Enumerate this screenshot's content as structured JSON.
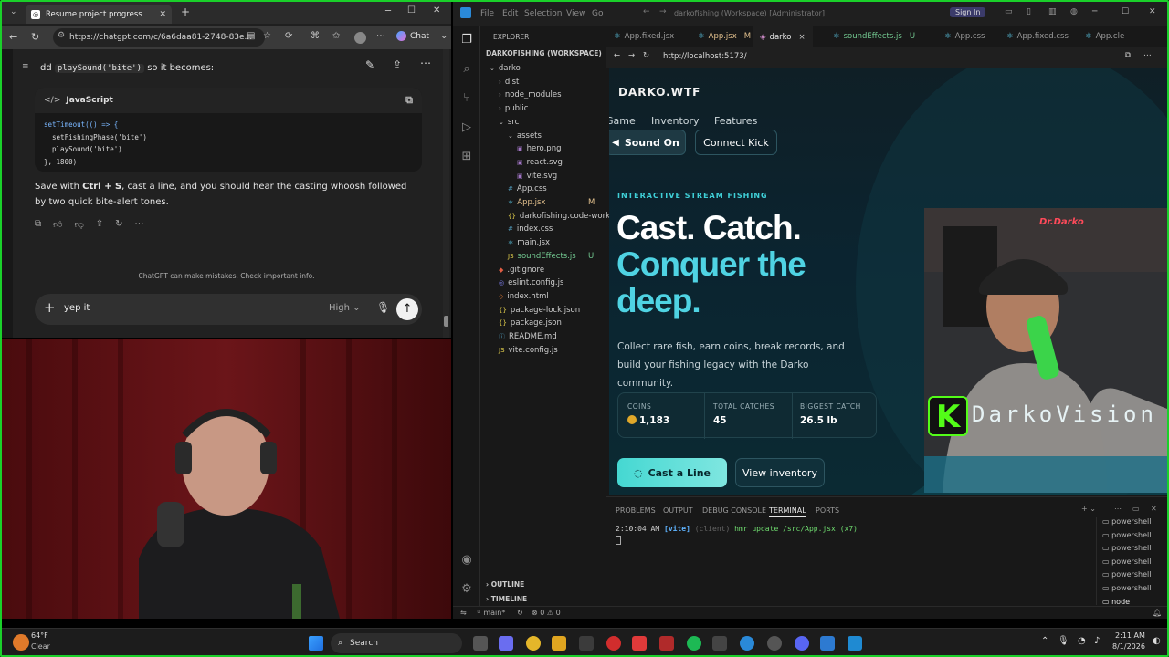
{
  "browser": {
    "tab_title": "Resume project progress",
    "url": "https://chatgpt.com/c/6a6daa81-2748-83e...",
    "chat_button": "Chat"
  },
  "chat": {
    "intro_prefix": "dd",
    "intro_code": "playSound('bite')",
    "intro_suffix": "so it becomes:",
    "code_lang": "JavaScript",
    "code_lines": [
      "setTimeout(() => {",
      "  setFishingPhase('bite')",
      "  playSound('bite')",
      "}, 1800)"
    ],
    "reply_pre": "Save with ",
    "reply_keys": "Ctrl + S",
    "reply_post": ", cast a line, and you should hear the casting whoosh followed by two quick bite-alert tones.",
    "disclaimer": "ChatGPT can make mistakes. Check important info.",
    "input_value": "yep it",
    "model_effort": "High"
  },
  "vscode": {
    "title": "darkofishing (Workspace) [Administrator]",
    "menu": [
      "File",
      "Edit",
      "Selection",
      "View",
      "Go"
    ],
    "sign_in": "Sign In",
    "explorer_header": "EXPLORER",
    "workspace": "DARKOFISHING (WORKSPACE)",
    "tree": [
      {
        "name": "darko",
        "depth": 0,
        "kind": "folder-open",
        "badge": ""
      },
      {
        "name": "dist",
        "depth": 1,
        "kind": "folder",
        "badge": ""
      },
      {
        "name": "node_modules",
        "depth": 1,
        "kind": "folder",
        "badge": ""
      },
      {
        "name": "public",
        "depth": 1,
        "kind": "folder",
        "badge": ""
      },
      {
        "name": "src",
        "depth": 1,
        "kind": "folder-open",
        "badge": ""
      },
      {
        "name": "assets",
        "depth": 2,
        "kind": "folder-open",
        "badge": ""
      },
      {
        "name": "hero.png",
        "depth": 3,
        "kind": "img",
        "badge": ""
      },
      {
        "name": "react.svg",
        "depth": 3,
        "kind": "img",
        "badge": ""
      },
      {
        "name": "vite.svg",
        "depth": 3,
        "kind": "img",
        "badge": ""
      },
      {
        "name": "App.css",
        "depth": 2,
        "kind": "css",
        "badge": ""
      },
      {
        "name": "App.jsx",
        "depth": 2,
        "kind": "jsx",
        "badge": "M"
      },
      {
        "name": "darkofishing.code-worksp...",
        "depth": 2,
        "kind": "json",
        "badge": ""
      },
      {
        "name": "index.css",
        "depth": 2,
        "kind": "css",
        "badge": ""
      },
      {
        "name": "main.jsx",
        "depth": 2,
        "kind": "jsx",
        "badge": ""
      },
      {
        "name": "soundEffects.js",
        "depth": 2,
        "kind": "js",
        "badge": "U"
      },
      {
        "name": ".gitignore",
        "depth": 1,
        "kind": "git",
        "badge": ""
      },
      {
        "name": "eslint.config.js",
        "depth": 1,
        "kind": "eslint",
        "badge": ""
      },
      {
        "name": "index.html",
        "depth": 1,
        "kind": "html",
        "badge": ""
      },
      {
        "name": "package-lock.json",
        "depth": 1,
        "kind": "json",
        "badge": ""
      },
      {
        "name": "package.json",
        "depth": 1,
        "kind": "json",
        "badge": ""
      },
      {
        "name": "README.md",
        "depth": 1,
        "kind": "md",
        "badge": ""
      },
      {
        "name": "vite.config.js",
        "depth": 1,
        "kind": "js",
        "badge": ""
      }
    ],
    "outline": "OUTLINE",
    "timeline": "TIMELINE",
    "tabs": [
      {
        "label": "App.fixed.jsx",
        "suffix": "",
        "active": false
      },
      {
        "label": "App.jsx",
        "suffix": "M",
        "active": false
      },
      {
        "label": "darko",
        "suffix": "×",
        "active": true
      },
      {
        "label": "soundEffects.js",
        "suffix": "U",
        "active": false
      },
      {
        "label": "App.css",
        "suffix": "",
        "active": false
      },
      {
        "label": "App.fixed.css",
        "suffix": "",
        "active": false
      },
      {
        "label": "App.cle",
        "suffix": "",
        "active": false
      }
    ],
    "preview_url": "http://localhost:5173/",
    "panel_tabs": [
      "PROBLEMS",
      "OUTPUT",
      "DEBUG CONSOLE",
      "TERMINAL",
      "PORTS"
    ],
    "terminal_time": "2:10:04 AM",
    "terminal_tag": "[vite]",
    "terminal_client": "(client)",
    "terminal_msg": "hmr update /src/App.jsx (x7)",
    "terminals": [
      "powershell",
      "powershell",
      "powershell",
      "powershell",
      "powershell",
      "powershell",
      "node"
    ],
    "status_branch": "main*",
    "status_problems": "⊗ 0 ⚠ 0"
  },
  "site": {
    "logo": "DARKO.WTF",
    "nav": [
      "Game",
      "Inventory",
      "Features"
    ],
    "sound_btn": "Sound On",
    "connect_btn": "Connect Kick",
    "eyebrow": "INTERACTIVE STREAM FISHING",
    "headline_1": "Cast. Catch.",
    "headline_2": "Conquer the",
    "headline_3": "deep.",
    "body": "Collect rare fish, earn coins, break records, and build your fishing legacy with the Darko community.",
    "stats": [
      {
        "label": "COINS",
        "value": "1,183"
      },
      {
        "label": "TOTAL CATCHES",
        "value": "45"
      },
      {
        "label": "BIGGEST CATCH",
        "value": "26.5 lb"
      }
    ],
    "cast_btn": "Cast a Line",
    "inventory_btn": "View inventory"
  },
  "overlay": {
    "brand": "DarkoVision",
    "badge": "K",
    "neon_sign": "Dr.Darko"
  },
  "taskbar": {
    "temp": "64°F",
    "weather": "Clear",
    "search": "Search",
    "time": "2:11 AM",
    "date": "8/1/2026"
  },
  "colors": {
    "accent_teal": "#3fd0d8",
    "frame_green": "#1ad02a",
    "kick_green": "#53fc18"
  }
}
